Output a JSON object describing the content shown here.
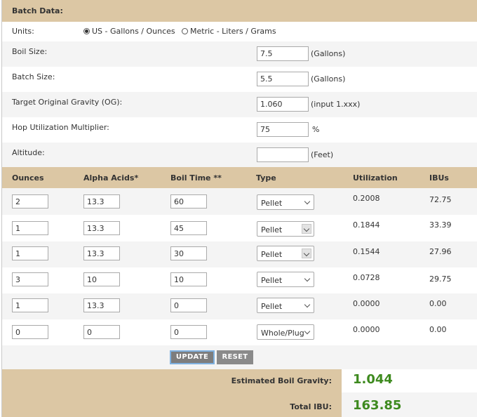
{
  "batch_header": "Batch Data:",
  "units": {
    "label": "Units:",
    "option_us": "US - Gallons / Ounces",
    "option_metric": "Metric - Liters / Grams"
  },
  "fields": {
    "boil_size": {
      "label": "Boil Size:",
      "value": "7.5",
      "unit": "(Gallons)"
    },
    "batch_size": {
      "label": "Batch Size:",
      "value": "5.5",
      "unit": "(Gallons)"
    },
    "og": {
      "label": "Target Original Gravity (OG):",
      "value": "1.060",
      "unit": "(input 1.xxx)"
    },
    "hop_util": {
      "label": "Hop Utilization Multiplier:",
      "value": "75",
      "unit": "%"
    },
    "altitude": {
      "label": "Altitude:",
      "value": "",
      "unit": "(Feet)"
    }
  },
  "table_headers": {
    "ounces": "Ounces",
    "alpha": "Alpha Acids*",
    "boil_time": "Boil Time **",
    "type": "Type",
    "utilization": "Utilization",
    "ibus": "IBUs"
  },
  "hops": [
    {
      "ounces": "2",
      "alpha": "13.3",
      "boil_time": "60",
      "type": "Pellet",
      "utilization": "0.2008",
      "ibus": "72.75"
    },
    {
      "ounces": "1",
      "alpha": "13.3",
      "boil_time": "45",
      "type": "Pellet",
      "utilization": "0.1844",
      "ibus": "33.39"
    },
    {
      "ounces": "1",
      "alpha": "13.3",
      "boil_time": "30",
      "type": "Pellet",
      "utilization": "0.1544",
      "ibus": "27.96"
    },
    {
      "ounces": "3",
      "alpha": "10",
      "boil_time": "10",
      "type": "Pellet",
      "utilization": "0.0728",
      "ibus": "29.75"
    },
    {
      "ounces": "1",
      "alpha": "13.3",
      "boil_time": "0",
      "type": "Pellet",
      "utilization": "0.0000",
      "ibus": "0.00"
    },
    {
      "ounces": "0",
      "alpha": "0",
      "boil_time": "0",
      "type": "Whole/Plug",
      "utilization": "0.0000",
      "ibus": "0.00"
    }
  ],
  "buttons": {
    "update": "UPDATE",
    "reset": "RESET"
  },
  "results": {
    "boil_gravity_label": "Estimated Boil Gravity:",
    "boil_gravity_value": "1.044",
    "total_ibu_label": "Total IBU:",
    "total_ibu_value": "163.85"
  },
  "colors": {
    "header_bg": "#dcc7a4",
    "result_green": "#3e8a1f"
  }
}
